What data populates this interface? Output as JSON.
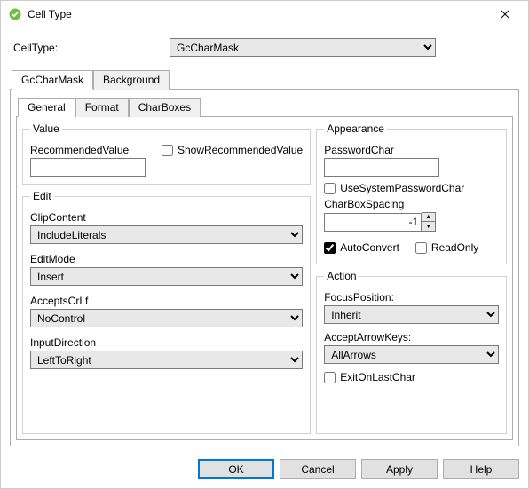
{
  "window": {
    "title": "Cell Type"
  },
  "header": {
    "label": "CellType:",
    "value": "GcCharMask"
  },
  "outerTabs": {
    "t0": "GcCharMask",
    "t1": "Background"
  },
  "innerTabs": {
    "t0": "General",
    "t1": "Format",
    "t2": "CharBoxes"
  },
  "value": {
    "legend": "Value",
    "recommended_label": "RecommendedValue",
    "recommended_value": "",
    "show_recommended_label": "ShowRecommendedValue"
  },
  "edit": {
    "legend": "Edit",
    "clip_label": "ClipContent",
    "clip_value": "IncludeLiterals",
    "mode_label": "EditMode",
    "mode_value": "Insert",
    "crlf_label": "AcceptsCrLf",
    "crlf_value": "NoControl",
    "dir_label": "InputDirection",
    "dir_value": "LeftToRight"
  },
  "appearance": {
    "legend": "Appearance",
    "pwd_label": "PasswordChar",
    "pwd_value": "",
    "use_system_pwd_label": "UseSystemPasswordChar",
    "spacing_label": "CharBoxSpacing",
    "spacing_value": "-1",
    "autoconvert_label": "AutoConvert",
    "readonly_label": "ReadOnly"
  },
  "action": {
    "legend": "Action",
    "focus_label": "FocusPosition:",
    "focus_value": "Inherit",
    "arrow_label": "AcceptArrowKeys:",
    "arrow_value": "AllArrows",
    "exit_label": "ExitOnLastChar"
  },
  "buttons": {
    "ok": "OK",
    "cancel": "Cancel",
    "apply": "Apply",
    "help": "Help"
  }
}
